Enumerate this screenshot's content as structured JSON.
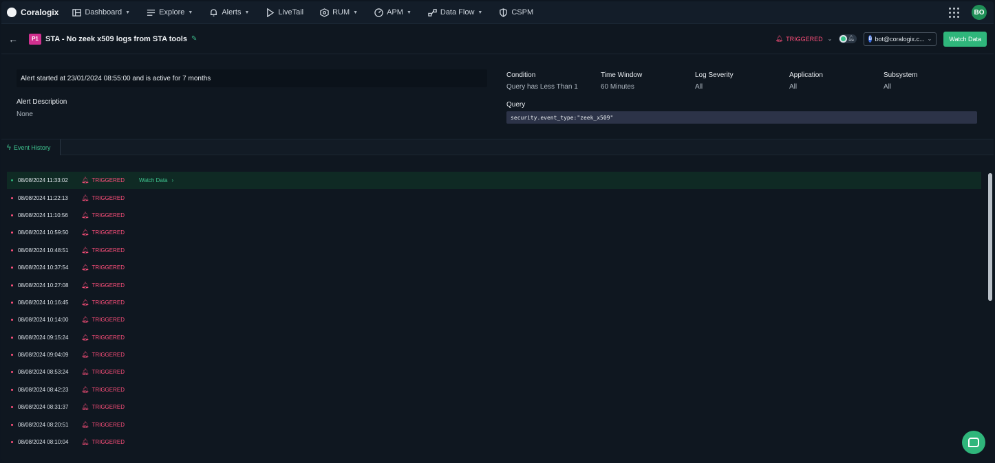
{
  "app": {
    "name": "Coralogix"
  },
  "nav": {
    "items": [
      {
        "label": "Dashboard",
        "icon": "dashboard-icon",
        "has_caret": true
      },
      {
        "label": "Explore",
        "icon": "explore-icon",
        "has_caret": true
      },
      {
        "label": "Alerts",
        "icon": "bell-icon",
        "has_caret": true
      },
      {
        "label": "LiveTail",
        "icon": "play-icon",
        "has_caret": false
      },
      {
        "label": "RUM",
        "icon": "rum-icon",
        "has_caret": true
      },
      {
        "label": "APM",
        "icon": "gauge-icon",
        "has_caret": true
      },
      {
        "label": "Data Flow",
        "icon": "dataflow-icon",
        "has_caret": true
      },
      {
        "label": "CSPM",
        "icon": "shield-icon",
        "has_caret": false
      }
    ],
    "avatar": "BO"
  },
  "alert": {
    "priority": "P1",
    "title": "STA - No zeek x509 logs from STA tools",
    "status": "TRIGGERED",
    "user": "bot@coralogix.c...",
    "user_initial": "B",
    "watch_button": "Watch Data"
  },
  "info": {
    "started_text": "Alert started at 23/01/2024 08:55:00  and is active for 7 months",
    "description_label": "Alert Description",
    "description_value": "None",
    "condition_label": "Condition",
    "condition_value": "Query has Less Than 1",
    "time_window_label": "Time Window",
    "time_window_value": "60 Minutes",
    "log_severity_label": "Log Severity",
    "log_severity_value": "All",
    "application_label": "Application",
    "application_value": "All",
    "subsystem_label": "Subsystem",
    "subsystem_value": "All",
    "query_label": "Query",
    "query_value": "security.event_type:\"zeek_x509\""
  },
  "tabs": {
    "event_history": "Event History"
  },
  "history": {
    "watch_link": "Watch Data",
    "rows": [
      {
        "timestamp": "08/08/2024 11:33:02",
        "status": "TRIGGERED"
      },
      {
        "timestamp": "08/08/2024 11:22:13",
        "status": "TRIGGERED"
      },
      {
        "timestamp": "08/08/2024 11:10:56",
        "status": "TRIGGERED"
      },
      {
        "timestamp": "08/08/2024 10:59:50",
        "status": "TRIGGERED"
      },
      {
        "timestamp": "08/08/2024 10:48:51",
        "status": "TRIGGERED"
      },
      {
        "timestamp": "08/08/2024 10:37:54",
        "status": "TRIGGERED"
      },
      {
        "timestamp": "08/08/2024 10:27:08",
        "status": "TRIGGERED"
      },
      {
        "timestamp": "08/08/2024 10:16:45",
        "status": "TRIGGERED"
      },
      {
        "timestamp": "08/08/2024 10:14:00",
        "status": "TRIGGERED"
      },
      {
        "timestamp": "08/08/2024 09:15:24",
        "status": "TRIGGERED"
      },
      {
        "timestamp": "08/08/2024 09:04:09",
        "status": "TRIGGERED"
      },
      {
        "timestamp": "08/08/2024 08:53:24",
        "status": "TRIGGERED"
      },
      {
        "timestamp": "08/08/2024 08:42:23",
        "status": "TRIGGERED"
      },
      {
        "timestamp": "08/08/2024 08:31:37",
        "status": "TRIGGERED"
      },
      {
        "timestamp": "08/08/2024 08:20:51",
        "status": "TRIGGERED"
      },
      {
        "timestamp": "08/08/2024 08:10:04",
        "status": "TRIGGERED"
      }
    ]
  },
  "colors": {
    "accent": "#2fb67b",
    "triggered": "#ff4f7b",
    "priority": "#d0308f",
    "background": "#0f1720"
  }
}
